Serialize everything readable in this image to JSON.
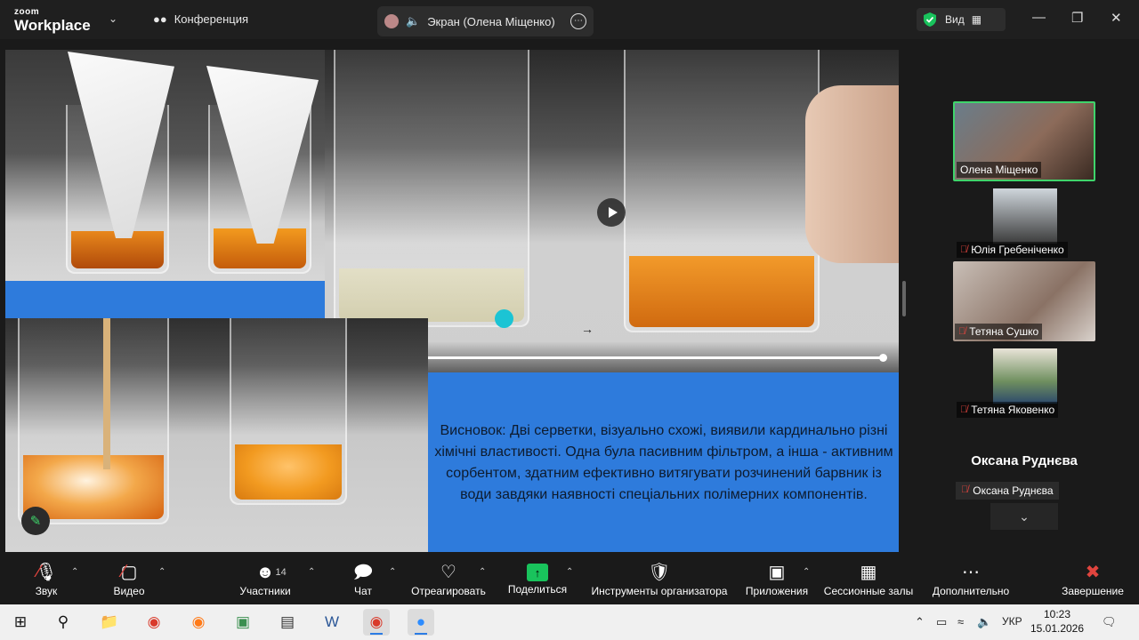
{
  "titlebar": {
    "brand_top": "zoom",
    "brand_bottom": "Workplace",
    "meeting_label": "Конференция",
    "screen_tab_label": "Экран (Олена Міщенко)",
    "view_label": "Вид"
  },
  "shared_content": {
    "conclusion_text": "Висновок: Дві серветки, візуально схожі, виявили кардинально різні хімічні властивості. Одна була пасивним фільтром, а інша - активним сорбентом, здатним ефективно витягувати розчинений барвник із води завдяки наявності спеціальних полімерних компонентів.",
    "video_progress": 1.0
  },
  "participants": {
    "tiles": [
      {
        "name": "Олена Міщенко",
        "muted": false,
        "active_speaker": true
      },
      {
        "name": "Юлія Гребеніченко",
        "muted": true
      },
      {
        "name": "Тетяна Сушко",
        "muted": true
      },
      {
        "name": "Тетяна Яковенко",
        "muted": true
      },
      {
        "name": "Оксана Руднєва",
        "muted": true
      }
    ],
    "no_video_title": "Оксана Руднєва"
  },
  "toolbar": {
    "audio": "Звук",
    "video": "Видео",
    "participants": "Участники",
    "participants_count": "14",
    "chat": "Чат",
    "react": "Отреагировать",
    "share": "Поделиться",
    "host_tools": "Инструменты организатора",
    "apps": "Приложения",
    "breakout": "Сессионные залы",
    "more": "Дополнительно",
    "end": "Завершение"
  },
  "taskbar": {
    "language": "УКР",
    "time": "10:23",
    "date": "15.01.2026"
  },
  "colors": {
    "share_background": "#2e7bdc",
    "active_speaker_border": "#3fd46b",
    "share_button": "#19c35c",
    "end_button": "#e0443e"
  }
}
